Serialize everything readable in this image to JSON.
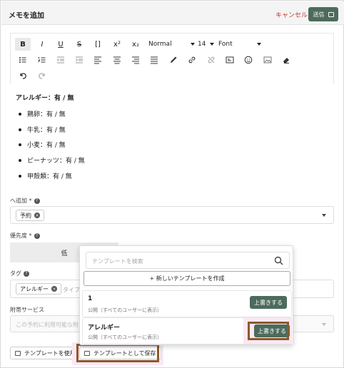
{
  "header": {
    "title": "メモを追加",
    "cancel_label": "キャンセル",
    "send_label": "送信"
  },
  "toolbar": {
    "row1": [
      "bold",
      "italic",
      "underline",
      "strikethrough",
      "code",
      "superscript",
      "subscript"
    ],
    "labels": {
      "bold": "B",
      "italic": "I",
      "underline": "U",
      "strike": "S",
      "code": "[]",
      "sup": "x²",
      "sub": "x₂"
    },
    "heading_select": "Normal",
    "size_select": "14",
    "font_select": "Font"
  },
  "content": {
    "heading": "アレルギー：有 / 無",
    "items": [
      "鶏卵：有 / 無",
      "牛乳：有 / 無",
      "小麦：有 / 無",
      "ピーナッツ：有 / 無",
      "甲殻類：有 / 無"
    ]
  },
  "add_to": {
    "label": "へ追加 *",
    "chip": "予約"
  },
  "priority": {
    "label": "優先度 *",
    "value": "低"
  },
  "tags": {
    "label": "タグ",
    "chip": "アレルギー",
    "placeholder": "タイプ"
  },
  "services": {
    "label": "附帯サービス",
    "placeholder": "この予約に利用可能な附"
  },
  "bottom": {
    "use_template": "テンプレートを使用",
    "save_template": "テンプレートとして保存"
  },
  "popup": {
    "search_placeholder": "テンプレートを検索",
    "new_template": "+ 新しいテンプレートを作成",
    "templates": [
      {
        "name": "1",
        "sub": "公開（すべてのユーザーに表示）",
        "button": "上書きする"
      },
      {
        "name": "アレルギー",
        "sub": "公開（すべてのユーザーに表示）",
        "button": "上書きする"
      }
    ]
  },
  "colors": {
    "primary_button": "#4c6b5c",
    "cancel": "#c0392b",
    "highlight": "#8a5a2b"
  }
}
